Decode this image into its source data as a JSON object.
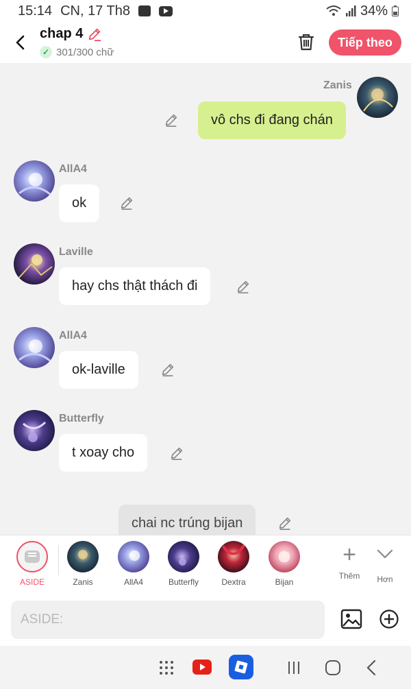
{
  "status": {
    "time": "15:14",
    "date": "CN, 17 Th8",
    "battery": "34%"
  },
  "header": {
    "title": "chap 4",
    "word_count": "301/300 chữ",
    "next_label": "Tiếp theo"
  },
  "messages": [
    {
      "sender": "Zanis",
      "text": "vô chs đi đang chán",
      "mine": true
    },
    {
      "sender": "AllA4",
      "text": "ok"
    },
    {
      "sender": "Laville",
      "text": "hay chs thật thách đi"
    },
    {
      "sender": "AllA4",
      "text": "ok-laville"
    },
    {
      "sender": "Butterfly",
      "text": "t xoay cho"
    },
    {
      "sender": "",
      "text": "chai nc trúng bijan",
      "narration": true
    }
  ],
  "characters": [
    {
      "name": "ASIDE"
    },
    {
      "name": "Zanis"
    },
    {
      "name": "AllA4"
    },
    {
      "name": "Butterfly"
    },
    {
      "name": "Dextra"
    },
    {
      "name": "Bijan"
    }
  ],
  "more": {
    "add_label": "Thêm",
    "more_label": "Hơn"
  },
  "composer": {
    "placeholder": "ASIDE:"
  },
  "colors": {
    "accent": "#f0536a",
    "mine_bubble": "#d7f08f",
    "background": "#f2f2f2"
  }
}
